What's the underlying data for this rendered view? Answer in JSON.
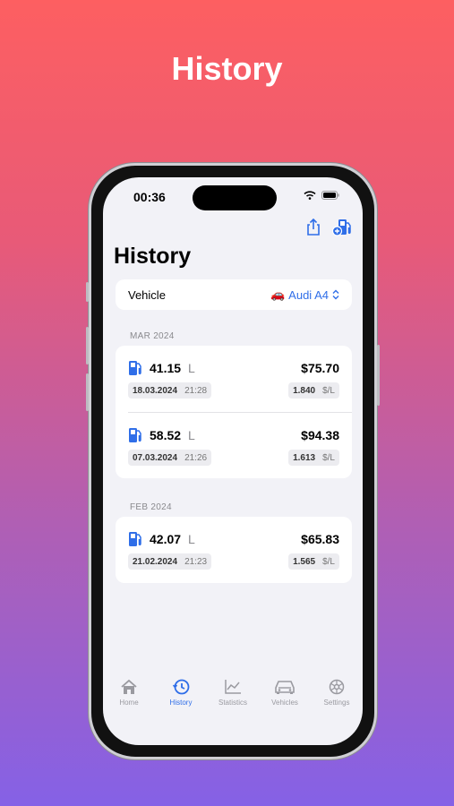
{
  "headline": "History",
  "status": {
    "time": "00:36"
  },
  "page": {
    "title": "History"
  },
  "vehicle": {
    "label": "Vehicle",
    "emoji": "🚗",
    "value": "Audi A4"
  },
  "sections": [
    {
      "label": "MAR 2024",
      "entries": [
        {
          "liters": "41.15",
          "unit": "L",
          "price": "$75.70",
          "date": "18.03.2024",
          "time": "21:28",
          "rate": "1.840",
          "rate_unit": "$/L"
        },
        {
          "liters": "58.52",
          "unit": "L",
          "price": "$94.38",
          "date": "07.03.2024",
          "time": "21:26",
          "rate": "1.613",
          "rate_unit": "$/L"
        }
      ]
    },
    {
      "label": "FEB 2024",
      "entries": [
        {
          "liters": "42.07",
          "unit": "L",
          "price": "$65.83",
          "date": "21.02.2024",
          "time": "21:23",
          "rate": "1.565",
          "rate_unit": "$/L"
        }
      ]
    }
  ],
  "tabs": [
    {
      "label": "Home",
      "icon": "house-icon",
      "active": false
    },
    {
      "label": "History",
      "icon": "clock-icon",
      "active": true
    },
    {
      "label": "Statistics",
      "icon": "chart-icon",
      "active": false
    },
    {
      "label": "Vehicles",
      "icon": "car-icon",
      "active": false
    },
    {
      "label": "Settings",
      "icon": "gear-icon",
      "active": false
    }
  ],
  "colors": {
    "accent": "#2f6ee8",
    "background": "#f2f2f7",
    "gradient_top": "#fd5f61",
    "gradient_bottom": "#8561e6"
  }
}
